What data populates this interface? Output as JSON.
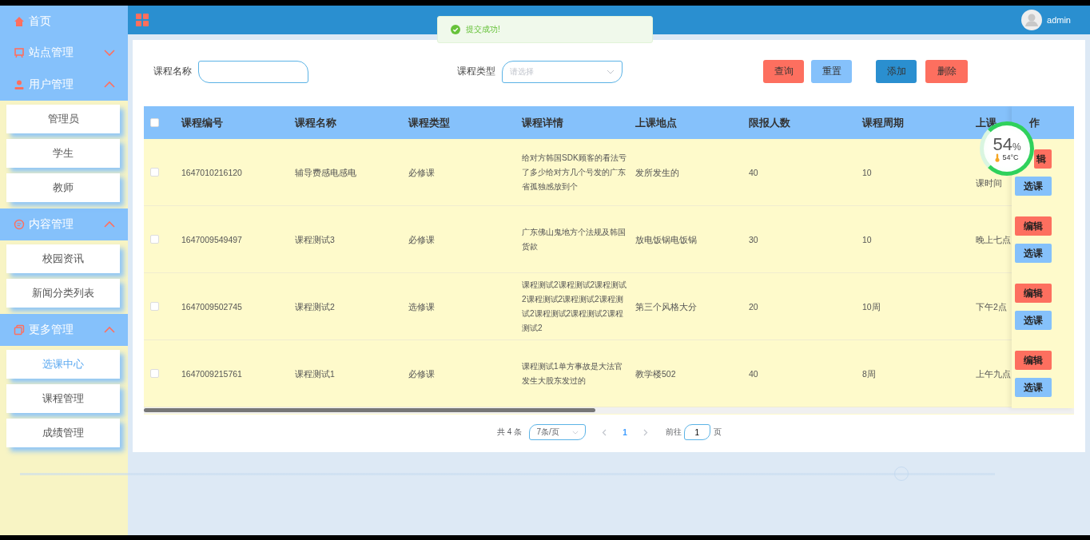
{
  "sidebar": {
    "menu": [
      {
        "label": "首页",
        "kind": "link"
      },
      {
        "label": "站点管理",
        "kind": "group",
        "expanded": false
      },
      {
        "label": "用户管理",
        "kind": "group",
        "expanded": true,
        "children": [
          {
            "label": "管理员",
            "selected": false
          },
          {
            "label": "学生",
            "selected": false
          },
          {
            "label": "教师",
            "selected": false
          }
        ]
      },
      {
        "label": "内容管理",
        "kind": "group",
        "expanded": true,
        "children": [
          {
            "label": "校园资讯",
            "selected": false
          },
          {
            "label": "新闻分类列表",
            "selected": false
          }
        ]
      },
      {
        "label": "更多管理",
        "kind": "group",
        "expanded": true,
        "children": [
          {
            "label": "选课中心",
            "selected": true
          },
          {
            "label": "课程管理",
            "selected": false
          },
          {
            "label": "成绩管理",
            "selected": false
          }
        ]
      }
    ]
  },
  "topbar": {
    "user": "admin"
  },
  "toast": {
    "message": "提交成功!"
  },
  "search": {
    "fields": [
      {
        "label": "课程名称",
        "kind": "input"
      },
      {
        "label": "课程类型",
        "kind": "select",
        "placeholder": "请选择"
      }
    ],
    "buttons": [
      {
        "label": "查询",
        "kind": "danger"
      },
      {
        "label": "重置",
        "kind": "light"
      },
      {
        "label": "添加",
        "kind": "primary"
      },
      {
        "label": "删除",
        "kind": "danger"
      }
    ]
  },
  "table": {
    "select_all": {
      "checked": false
    },
    "columns": [
      "课程编号",
      "课程名称",
      "课程类型",
      "课程详情",
      "上课地点",
      "限报人数",
      "课程周期",
      "上课"
    ],
    "action_column": "作",
    "rows": [
      {
        "checked": false,
        "cells": [
          "1647010216120",
          "辅导费感电感电",
          "必修课",
          "给对方韩国SDK顾客的看法亏了多少给对方几个号发的广东省孤独感放到个",
          "发所发生的",
          "40",
          "10",
          "课时间"
        ],
        "actions": [
          "辑",
          "选课"
        ]
      },
      {
        "checked": false,
        "cells": [
          "1647009549497",
          "课程测试3",
          "必修课",
          "广东佛山鬼地方个法规及韩国货款",
          "放电饭锅电饭锅",
          "30",
          "10",
          "晚上七点"
        ],
        "actions": [
          "编辑",
          "选课"
        ]
      },
      {
        "checked": false,
        "cells": [
          "1647009502745",
          "课程测试2",
          "选修课",
          "课程测试2课程测试2课程测试2课程测试2课程测试2课程测试2课程测试2课程测试2课程测试2",
          "第三个风格大分",
          "20",
          "10周",
          "下午2点"
        ],
        "actions": [
          "编辑",
          "选课"
        ]
      },
      {
        "checked": false,
        "cells": [
          "1647009215761",
          "课程测试1",
          "必修课",
          "课程测试1单方事故是大法官发生大股东发过的",
          "教学楼502",
          "40",
          "8周",
          "上午九点"
        ],
        "actions": [
          "编辑",
          "选课"
        ]
      }
    ]
  },
  "pagination": {
    "total": "共 4 条",
    "page_size": "7条/页",
    "pages": [
      {
        "label": "1",
        "selected": true
      }
    ],
    "goto_label": "前往",
    "goto_value": "1",
    "goto_suffix": "页"
  },
  "gauge": {
    "value": "54",
    "unit": "%",
    "temperature": "54°C"
  },
  "slider": {
    "level": 0.904
  }
}
